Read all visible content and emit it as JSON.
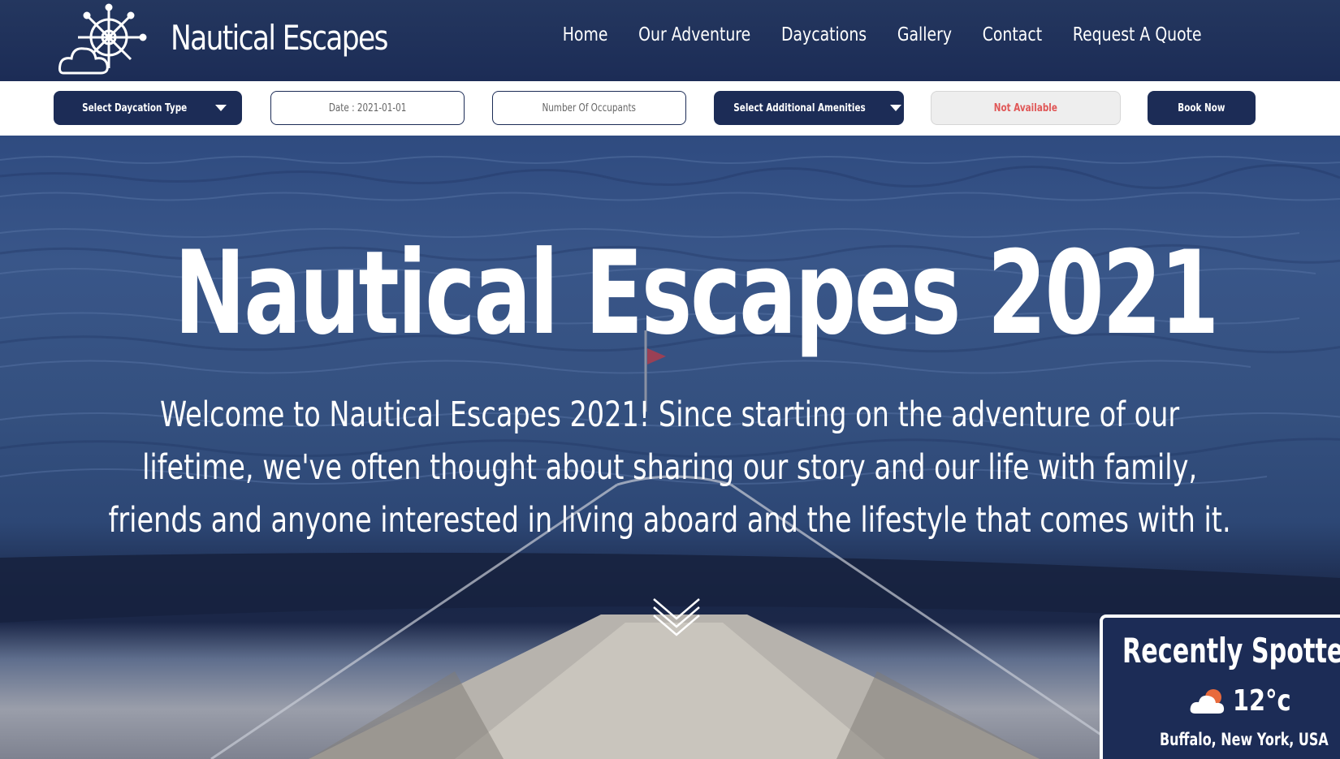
{
  "header": {
    "brand": "Nautical Escapes",
    "nav": [
      "Home",
      "Our Adventure",
      "Daycations",
      "Gallery",
      "Contact",
      "Request A Quote"
    ]
  },
  "booking": {
    "daycation_select": "Select Daycation Type",
    "date_field": "Date : 2021-01-01",
    "occupants_placeholder": "Number Of Occupants",
    "amenities_select": "Select Additional Amenities",
    "availability_status": "Not Available",
    "book_button": "Book Now"
  },
  "hero": {
    "title": "Nautical Escapes 2021",
    "text": "Welcome to Nautical Escapes 2021! Since starting on the adventure of our lifetime, we've often thought about sharing our story and our life with family, friends and anyone interested in living aboard and the lifestyle that comes with it."
  },
  "weather": {
    "title": "Recently Spotted",
    "temperature": "12°c",
    "location": "Buffalo, New York, USA"
  },
  "colors": {
    "navy": "#1c2c56",
    "status_red": "#e05757",
    "white": "#ffffff"
  },
  "icons": {
    "logo": "ship-wheel-cloud-icon",
    "dropdown": "caret-down-icon",
    "scroll": "double-chevron-down-icon",
    "weather": "cloud-sun-icon"
  }
}
